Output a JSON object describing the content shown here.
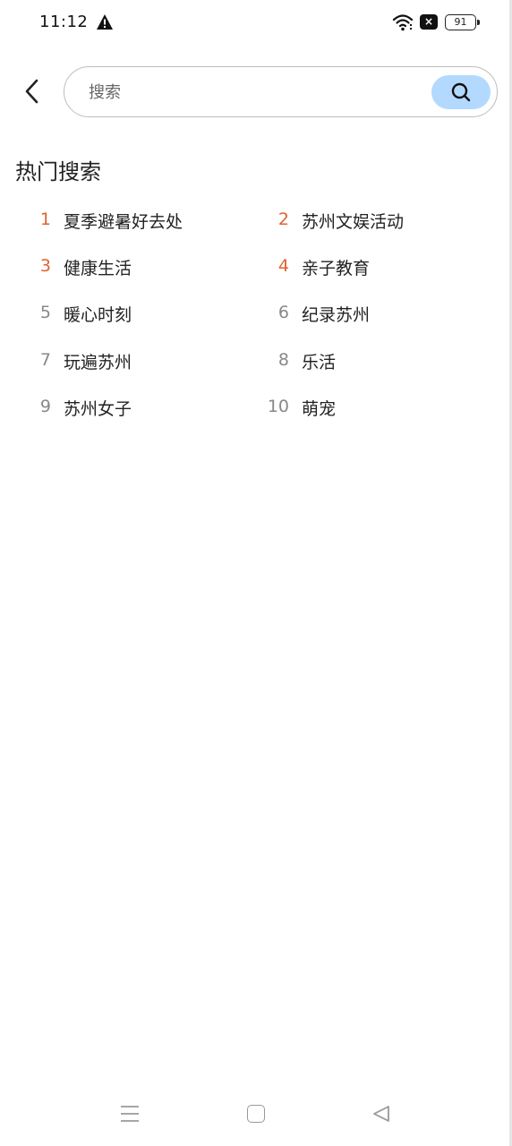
{
  "status_bar": {
    "time": "11:12",
    "battery": "91"
  },
  "search": {
    "placeholder": "搜索"
  },
  "hot_search": {
    "title": "热门搜索",
    "items": [
      {
        "rank": "1",
        "label": "夏季避暑好去处",
        "highlight": true
      },
      {
        "rank": "2",
        "label": "苏州文娱活动",
        "highlight": true
      },
      {
        "rank": "3",
        "label": "健康生活",
        "highlight": true
      },
      {
        "rank": "4",
        "label": "亲子教育",
        "highlight": true
      },
      {
        "rank": "5",
        "label": "暖心时刻",
        "highlight": false
      },
      {
        "rank": "6",
        "label": "纪录苏州",
        "highlight": false
      },
      {
        "rank": "7",
        "label": "玩遍苏州",
        "highlight": false
      },
      {
        "rank": "8",
        "label": "乐活",
        "highlight": false
      },
      {
        "rank": "9",
        "label": "苏州女子",
        "highlight": false
      },
      {
        "rank": "10",
        "label": "萌宠",
        "highlight": false
      }
    ]
  },
  "colors": {
    "accent_rank": "#e0632f",
    "search_button": "#b3d9ff"
  }
}
